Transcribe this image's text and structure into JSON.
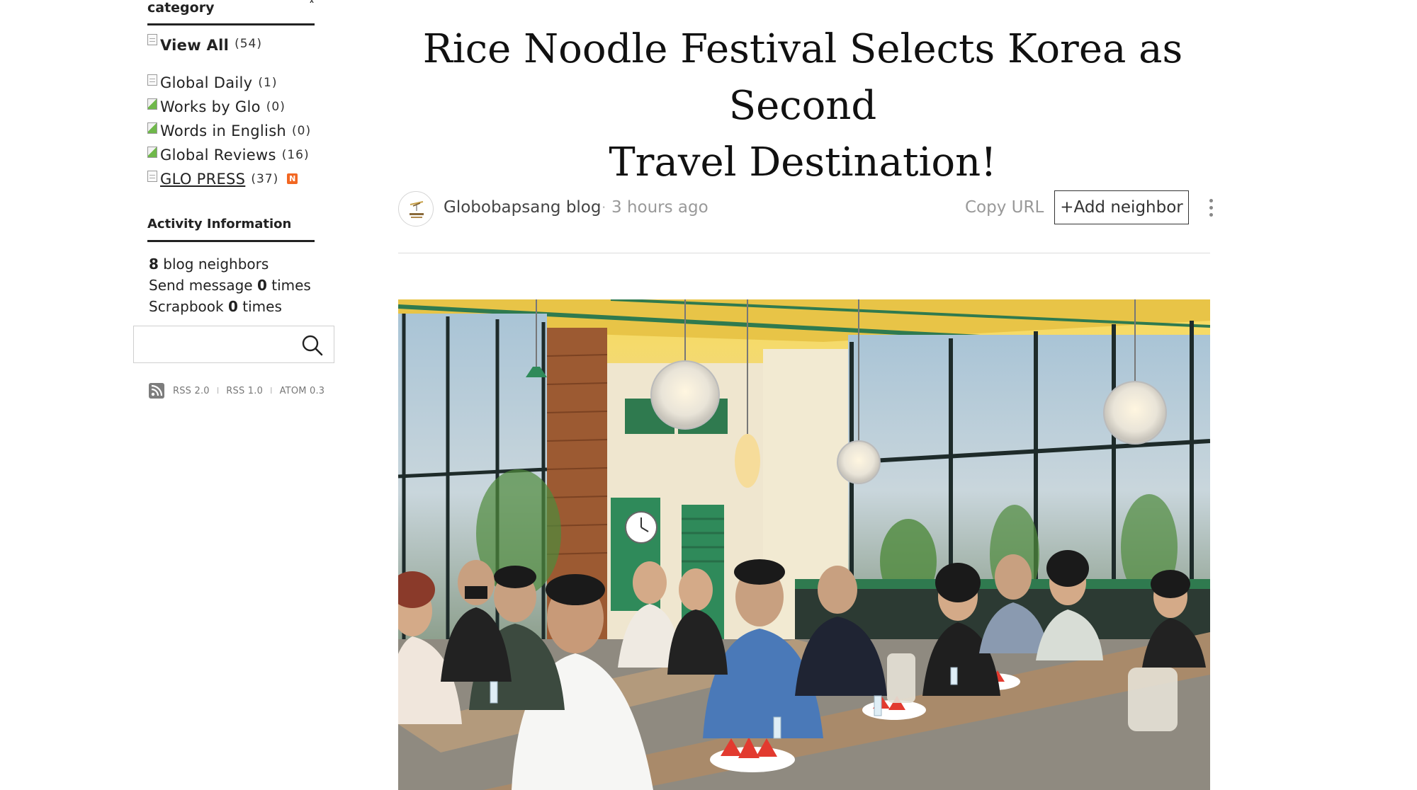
{
  "sidebar": {
    "category_title": "category",
    "category_toggle": "˄",
    "categories": [
      {
        "label": "View All",
        "count": "(54)"
      },
      {
        "label": "Global Daily",
        "count": "(1)"
      },
      {
        "label": "Works by Glo",
        "count": "(0)"
      },
      {
        "label": "Words in English",
        "count": "(0)"
      },
      {
        "label": "Global Reviews",
        "count": "(16)"
      },
      {
        "label": "GLO PRESS ",
        "count": "(37)",
        "badge": "N"
      }
    ],
    "activity_title": "Activity Information",
    "activity": {
      "neighbors_count": "8",
      "neighbors_text": " blog neighbors",
      "message_prefix": "Send message ",
      "message_count": "0",
      "message_suffix": " times",
      "scrapbook_prefix": "Scrapbook ",
      "scrapbook_count": "0",
      "scrapbook_suffix": " times"
    },
    "search": {
      "value": "",
      "icon": "search-icon"
    },
    "rss": {
      "icon": "rss-icon",
      "links": [
        "RSS 2.0",
        "RSS 1.0",
        "ATOM 0.3"
      ],
      "separator": "I"
    }
  },
  "post": {
    "title_line1": "Rice Noodle Festival Selects Korea as Second",
    "title_line2": "Travel Destination!",
    "blog_name": "Globobapsang blog",
    "dot": "·",
    "time": "3 hours ago",
    "copy_url": "Copy URL",
    "add_neighbor": "+Add neighbor",
    "more_icon": "more-vertical-icon"
  },
  "colors": {
    "accent_badge": "#f26722",
    "text_primary": "#222222",
    "text_muted": "#999999",
    "restaurant_green": "#2f7a4f",
    "ceiling_yellow": "#f1c84a"
  }
}
